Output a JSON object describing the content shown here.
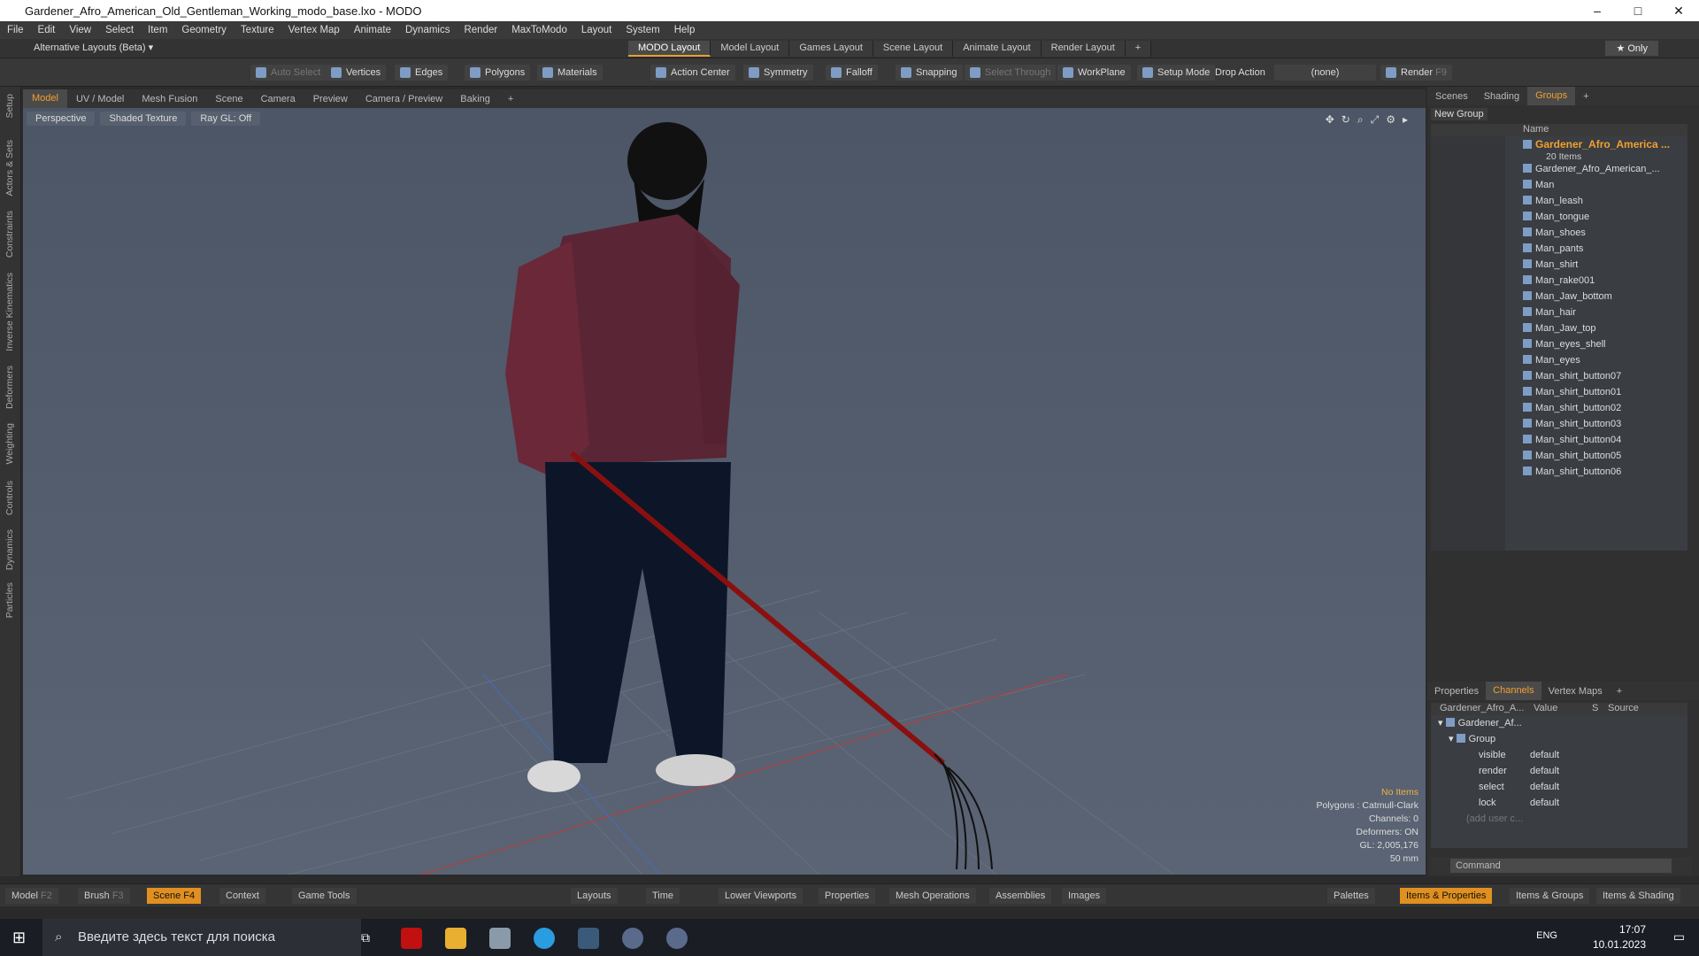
{
  "window": {
    "title": "Gardener_Afro_American_Old_Gentleman_Working_modo_base.lxo - MODO",
    "min": "–",
    "max": "□",
    "close": "✕"
  },
  "menu": [
    "File",
    "Edit",
    "View",
    "Select",
    "Item",
    "Geometry",
    "Texture",
    "Vertex Map",
    "Animate",
    "Dynamics",
    "Render",
    "MaxToModo",
    "Layout",
    "System",
    "Help"
  ],
  "layouts": {
    "alt": "Alternative Layouts (Beta) ▾",
    "tabs": [
      "MODO Layout",
      "Model Layout",
      "Games Layout",
      "Scene Layout",
      "Animate Layout",
      "Render Layout"
    ],
    "plus": "+",
    "only": "★ Only"
  },
  "toolbar": {
    "auto_select": "Auto Select",
    "vertices": "Vertices",
    "edges": "Edges",
    "polygons": "Polygons",
    "materials": "Materials",
    "action_center": "Action Center",
    "symmetry": "Symmetry",
    "falloff": "Falloff",
    "snapping": "Snapping",
    "select_through": "Select Through",
    "workplane": "WorkPlane",
    "setup_mode": "Setup Mode",
    "drop_action": "Drop Action",
    "drop_value": "(none)",
    "render": "Render",
    "render_key": "F9"
  },
  "side_tabs": [
    "Setup",
    "Actors & Sets",
    "Constraints",
    "Inverse Kinematics",
    "Deformers",
    "Weighting",
    "Controls",
    "Dynamics",
    "Particles"
  ],
  "vp_tabs": [
    "Model",
    "UV / Model",
    "Mesh Fusion",
    "Scene",
    "Camera",
    "Preview",
    "Camera / Preview",
    "Baking",
    "+"
  ],
  "viewport": {
    "perspective": "Perspective",
    "shading": "Shaded Texture",
    "raygl": "Ray GL: Off",
    "info": [
      "No Items",
      "Polygons : Catmull-Clark",
      "Channels: 0",
      "Deformers: ON",
      "GL: 2,005,176",
      "50 mm"
    ]
  },
  "right_tabs": [
    "Scenes",
    "Shading",
    "Groups",
    "+"
  ],
  "groups": {
    "new_group": "New Group",
    "name_col": "Name",
    "group_name": "Gardener_Afro_America ...",
    "count": "20 Items",
    "items": [
      "Gardener_Afro_American_...",
      "Man",
      "Man_leash",
      "Man_tongue",
      "Man_shoes",
      "Man_pants",
      "Man_shirt",
      "Man_rake001",
      "Man_Jaw_bottom",
      "Man_hair",
      "Man_Jaw_top",
      "Man_eyes_shell",
      "Man_eyes",
      "Man_shirt_button07",
      "Man_shirt_button01",
      "Man_shirt_button02",
      "Man_shirt_button03",
      "Man_shirt_button04",
      "Man_shirt_button05",
      "Man_shirt_button06"
    ]
  },
  "channels": {
    "tabs": [
      "Properties",
      "Channels",
      "Vertex Maps",
      "+"
    ],
    "head": {
      "name": "Gardener_Afro_A...",
      "value": "Value",
      "s": "S",
      "source": "Source"
    },
    "root": "Gardener_Af...",
    "group": "Group",
    "rows": [
      {
        "name": "visible",
        "value": "default"
      },
      {
        "name": "render",
        "value": "default"
      },
      {
        "name": "select",
        "value": "default"
      },
      {
        "name": "lock",
        "value": "default"
      }
    ],
    "add": "(add user c..."
  },
  "command": {
    "placeholder": "Command"
  },
  "bottom": {
    "model": "Model",
    "f2": "F2",
    "brush": "Brush",
    "f3": "F3",
    "scene": "Scene",
    "f4": "F4",
    "context": "Context",
    "game_tools": "Game Tools",
    "layouts": "Layouts",
    "time": "Time",
    "lower": "Lower Viewports",
    "properties": "Properties",
    "mesh_ops": "Mesh Operations",
    "assemblies": "Assemblies",
    "images": "Images",
    "palettes": "Palettes",
    "items_props": "Items & Properties",
    "items_groups": "Items & Groups",
    "items_shading": "Items & Shading"
  },
  "taskbar": {
    "search": "Введите здесь текст для поиска",
    "lang": "ENG",
    "time": "17:07",
    "date": "10.01.2023"
  }
}
